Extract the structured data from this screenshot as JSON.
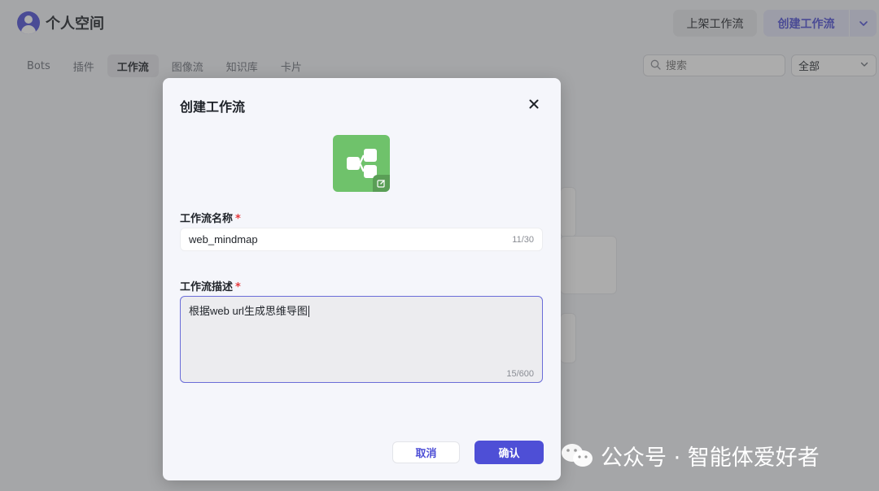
{
  "header": {
    "title": "个人空间",
    "publish_button": "上架工作流",
    "create_button": "创建工作流"
  },
  "tabs": [
    {
      "label": "Bots"
    },
    {
      "label": "插件"
    },
    {
      "label": "工作流",
      "active": true
    },
    {
      "label": "图像流"
    },
    {
      "label": "知识库"
    },
    {
      "label": "卡片"
    }
  ],
  "search": {
    "placeholder": "搜索"
  },
  "filter": {
    "selected": "全部"
  },
  "modal": {
    "title": "创建工作流",
    "name_label": "工作流名称",
    "name_value": "web_mindmap",
    "name_counter": "11/30",
    "desc_label": "工作流描述",
    "desc_value": "根据web url生成思维导图",
    "desc_counter": "15/600",
    "required_mark": "*",
    "cancel_button": "取消",
    "confirm_button": "确认"
  },
  "watermark": {
    "text": "公众号 · 智能体爱好者"
  },
  "colors": {
    "accent": "#4e4fd6",
    "workflow_icon": "#6fc26b",
    "required": "#e5383b"
  },
  "icons": [
    "user-avatar-icon",
    "chevron-down-icon",
    "search-icon",
    "close-icon",
    "workflow-icon",
    "edit-icon",
    "wechat-logo-icon"
  ]
}
